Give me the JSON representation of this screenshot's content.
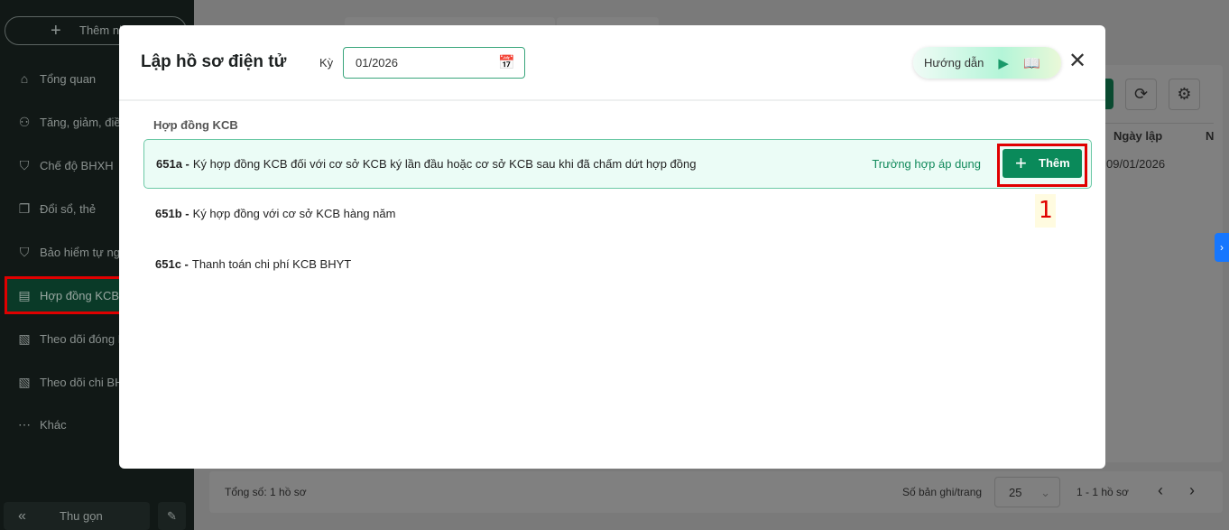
{
  "sidebar": {
    "add_label": "Thêm nha",
    "items": [
      {
        "label": "Tổng quan",
        "icon": "home-icon"
      },
      {
        "label": "Tăng, giảm, điều",
        "icon": "user-up-icon"
      },
      {
        "label": "Chế độ BHXH",
        "icon": "shield-heart-icon"
      },
      {
        "label": "Đổi sổ, thẻ",
        "icon": "copy-icon"
      },
      {
        "label": "Bảo hiểm tự ngu",
        "icon": "shield-icon"
      },
      {
        "label": "Hợp đồng KCB",
        "icon": "scroll-icon"
      },
      {
        "label": "Theo dõi đóng B",
        "icon": "c12-doc-icon"
      },
      {
        "label": "Theo dõi chi BH",
        "icon": "doc-icon"
      },
      {
        "label": "Khác",
        "icon": "more-icon"
      }
    ],
    "collapse_label": "Thu gọn"
  },
  "background": {
    "table_header": [
      "Ngày lập",
      "N"
    ],
    "table_row": [
      "09/01/2026"
    ],
    "footer": {
      "total": "Tổng số: 1 hồ sơ",
      "per_page_label": "Số bản ghi/trang",
      "per_page": "25",
      "range": "1 - 1 hồ sơ"
    }
  },
  "modal": {
    "title": "Lập hồ sơ điện tử",
    "period_label": "Kỳ",
    "period_value": "01/2026",
    "guide_label": "Hướng dẫn",
    "section": "Hợp đồng KCB",
    "rows": [
      {
        "code": "651a -",
        "text": "Ký hợp đồng KCB đối với cơ sở KCB ký lần đầu hoặc cơ sở KCB sau khi đã chấm dứt hợp đồng",
        "apply": "Trường hợp áp dụng",
        "add": "Thêm"
      },
      {
        "code": "651b -",
        "text": "Ký hợp đồng với cơ sở KCB hàng năm"
      },
      {
        "code": "651c -",
        "text": "Thanh toán chi phí KCB BHYT"
      }
    ]
  },
  "annotation": {
    "marker": "1"
  }
}
